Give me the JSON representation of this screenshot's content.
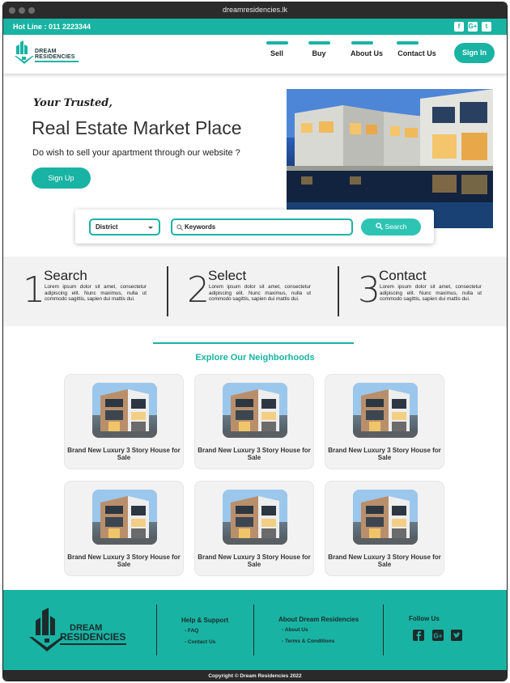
{
  "browser": {
    "url": "dreamresidencies.lk"
  },
  "topbar": {
    "hotline": "Hot Line : 011 2223344",
    "social_icons": [
      "facebook-icon",
      "google-plus-icon",
      "twitter-icon"
    ]
  },
  "brand": {
    "line1": "DREAM",
    "line2": "RESIDENCIES"
  },
  "nav": {
    "items": [
      {
        "label": "Sell"
      },
      {
        "label": "Buy"
      },
      {
        "label": "About Us"
      },
      {
        "label": "Contact  Us"
      }
    ],
    "signin_label": "Sign In"
  },
  "hero": {
    "script": "Your Trusted,",
    "title": "Real Estate Market Place",
    "subtitle": "Do wish to sell your apartment through our website ?",
    "signup_label": "Sign Up"
  },
  "search": {
    "district_value": "District",
    "keywords_value": "Keywords",
    "button_label": "Search"
  },
  "steps": [
    {
      "number": "1",
      "title": "Search",
      "body": "Lorem ipsum dolor sit amet, consectetur adipiscing elit. Nunc maximus, nulla ut commodo sagittis, sapien dui mattis dui."
    },
    {
      "number": "2",
      "title": "Select",
      "body": "Lorem ipsum dolor sit amet, consectetur adipiscing elit. Nunc maximus, nulla ut commodo sagittis, sapien dui mattis dui."
    },
    {
      "number": "3",
      "title": "Contact",
      "body": "Lorem ipsum dolor sit amet, consectetur adipiscing elit. Nunc maximus, nulla ut commodo sagittis, sapien dui mattis dui."
    }
  ],
  "neighborhoods": {
    "title": "Explore Our Neighborhoods",
    "listings": [
      {
        "caption": "Brand New Luxury 3 Story House for Sale"
      },
      {
        "caption": "Brand New Luxury 3 Story House for Sale"
      },
      {
        "caption": "Brand New Luxury 3 Story House for Sale"
      },
      {
        "caption": "Brand New Luxury 3 Story House for Sale"
      },
      {
        "caption": "Brand New Luxury 3 Story House for Sale"
      },
      {
        "caption": "Brand New Luxury 3 Story House for Sale"
      }
    ]
  },
  "footer": {
    "help": {
      "title": "Help & Support",
      "links": [
        "- FAQ",
        "- Contact Us"
      ]
    },
    "about": {
      "title": "About Dream Residencies",
      "links": [
        "- About Us",
        "- Terms & Conditions"
      ]
    },
    "follow": {
      "title": "Follow Us",
      "icons": [
        "facebook-icon",
        "google-plus-icon",
        "twitter-icon"
      ]
    },
    "copyright": "Copyright © Dream Residencies 2022"
  },
  "colors": {
    "accent": "#19b3a3",
    "dark": "#2b2b2b",
    "panel": "#f2f2f2"
  }
}
